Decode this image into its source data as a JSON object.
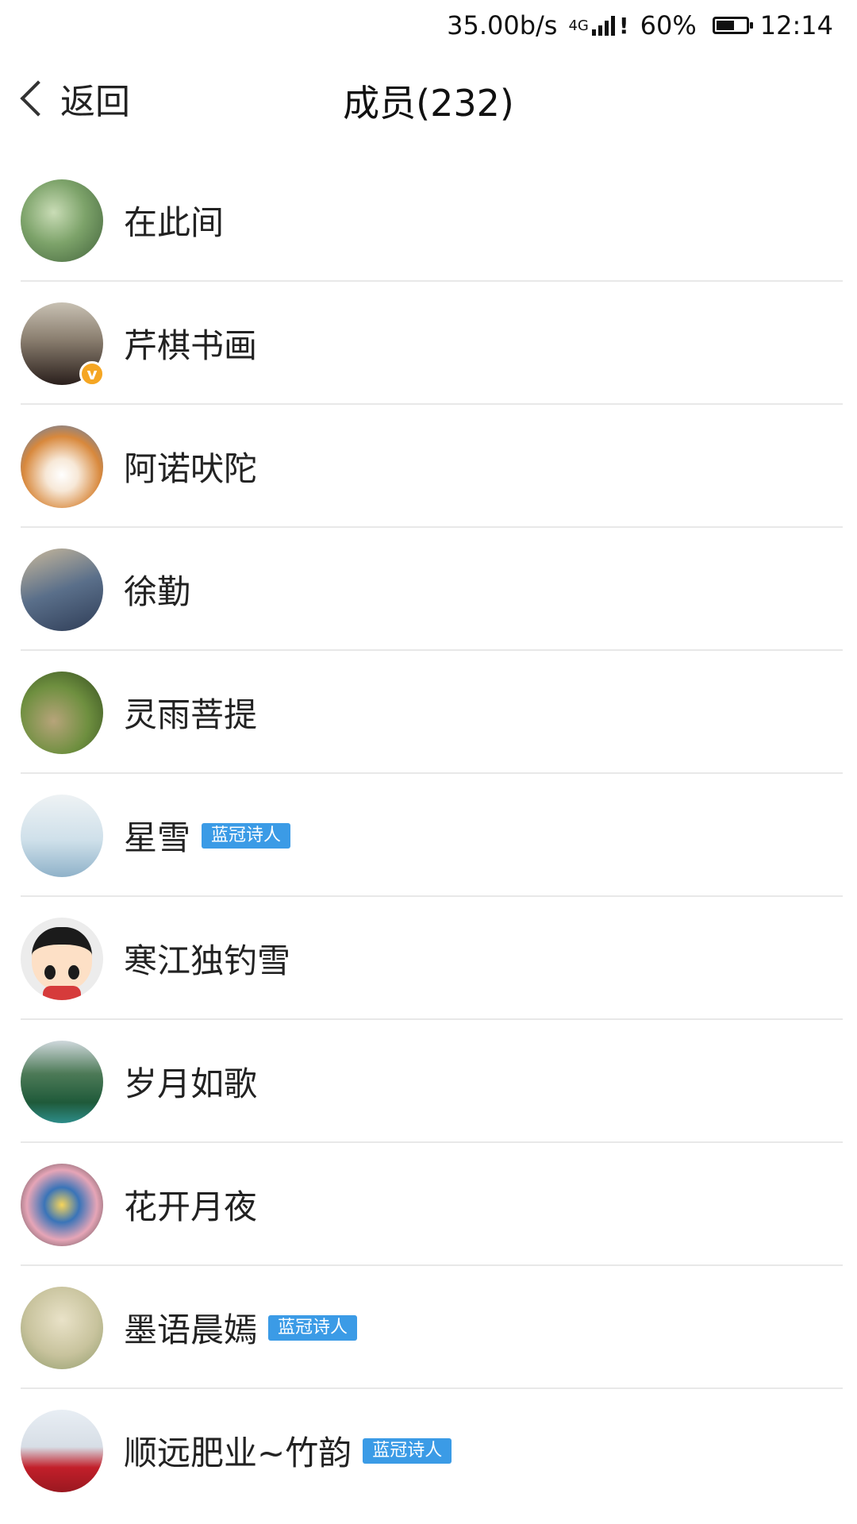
{
  "status_bar": {
    "net_speed": "35.00b/s",
    "network_type": "4G",
    "battery": "60%",
    "battery_level": 0.6,
    "time": "12:14",
    "icons": [
      "signal-icon",
      "battery-icon"
    ]
  },
  "nav": {
    "back_label": "返回",
    "title": "成员(232)",
    "back_icon": "chevron-left-icon"
  },
  "members": [
    {
      "name": "在此间",
      "badge": ""
    },
    {
      "name": "芹棋书画",
      "badge": "",
      "verified": true
    },
    {
      "name": "阿诺吠陀",
      "badge": ""
    },
    {
      "name": "徐勤",
      "badge": ""
    },
    {
      "name": "灵雨菩提",
      "badge": ""
    },
    {
      "name": "星雪",
      "badge": "蓝冠诗人"
    },
    {
      "name": "寒江独钓雪",
      "badge": ""
    },
    {
      "name": "岁月如歌",
      "badge": ""
    },
    {
      "name": "花开月夜",
      "badge": ""
    },
    {
      "name": "墨语晨嫣",
      "badge": "蓝冠诗人"
    },
    {
      "name": "顺远肥业~竹韵",
      "badge": "蓝冠诗人"
    }
  ],
  "verified_mark": "v",
  "colors": {
    "badge_bg": "#3b9be6",
    "verified_bg": "#f5a623",
    "divider": "#e8e8e8"
  }
}
